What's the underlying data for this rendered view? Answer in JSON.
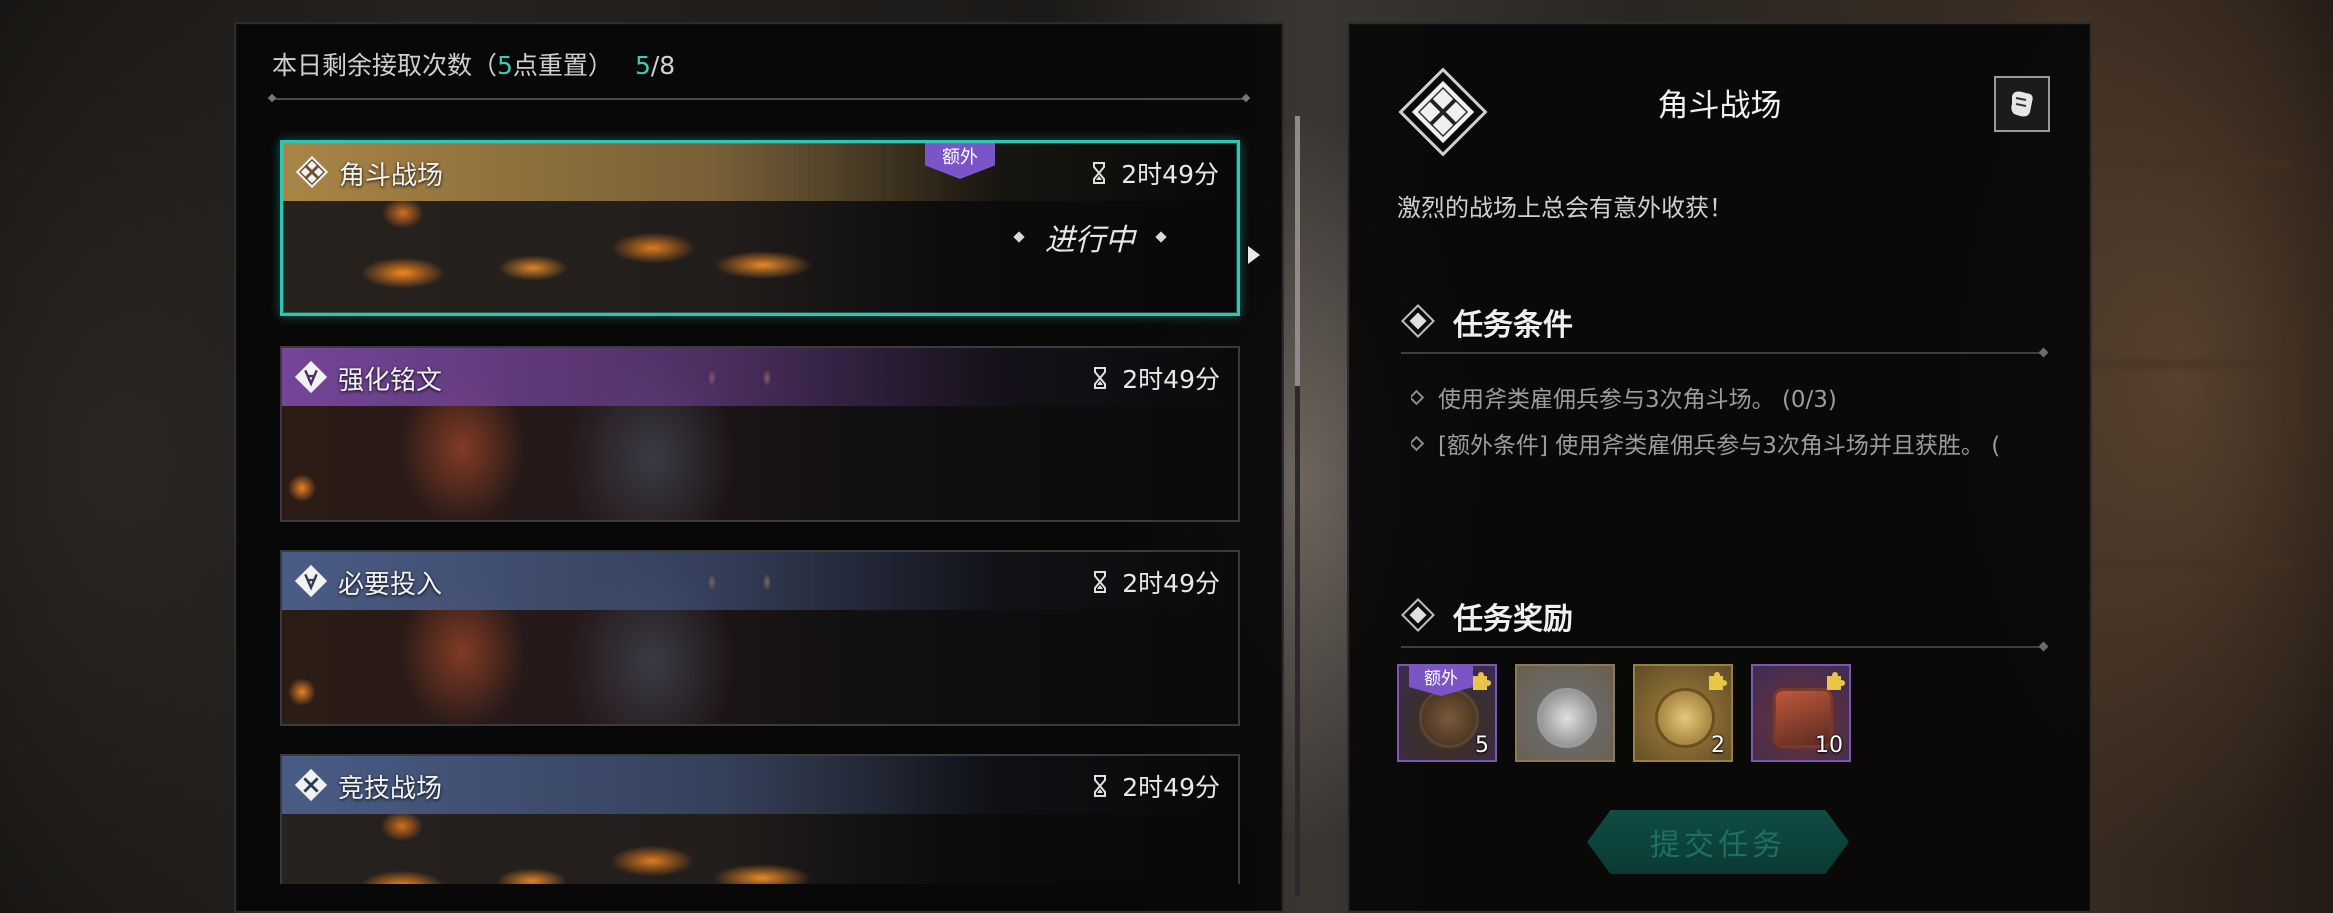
{
  "header": {
    "counter_prefix": "本日剩余接取次数（",
    "reset_hour": "5",
    "reset_suffix": "点重置）",
    "used": "5",
    "total": "/8"
  },
  "quests": [
    {
      "title": "角斗战场",
      "time": "2时49分",
      "badge": "额外",
      "status": "进行中",
      "band": "gold"
    },
    {
      "title": "强化铭文",
      "time": "2时49分",
      "band": "purple"
    },
    {
      "title": "必要投入",
      "time": "2时49分",
      "band": "blue"
    },
    {
      "title": "竞技战场",
      "time": "2时49分",
      "band": "blue"
    }
  ],
  "detail": {
    "title": "角斗战场",
    "description": "激烈的战场上总会有意外收获！",
    "conditions_header": "任务条件",
    "conditions": [
      "使用斧类雇佣兵参与3次角斗场。 (0/3)",
      "[额外条件] 使用斧类雇佣兵参与3次角斗场并且获胜。 ("
    ],
    "rewards_header": "任务奖励",
    "rewards": [
      {
        "qty": "5",
        "extra": "额外",
        "icon": "shield-coin-icon"
      },
      {
        "qty": "",
        "icon": "silver-coins-icon"
      },
      {
        "qty": "2",
        "icon": "gold-medal-icon"
      },
      {
        "qty": "10",
        "icon": "loot-bag-icon"
      }
    ],
    "submit_label": "提交任务"
  },
  "colors": {
    "accent_teal": "#2fc7b3",
    "badge_purple": "#7b55c8",
    "band_gold": "#b08a48",
    "band_purple": "#7848a0",
    "band_blue": "#4c608c"
  }
}
